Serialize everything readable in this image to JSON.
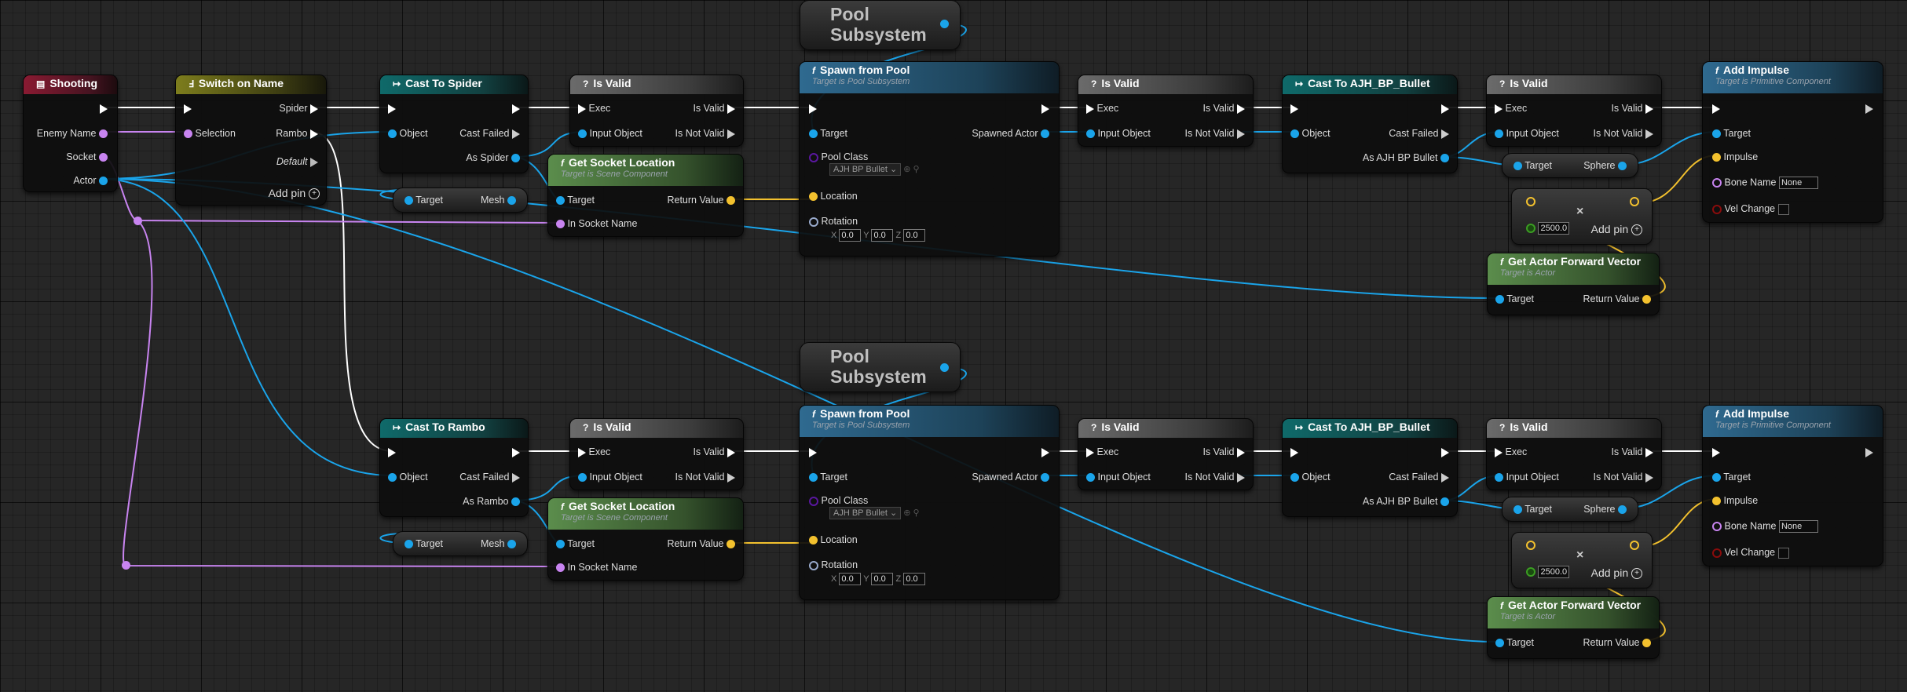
{
  "event_node": {
    "title": "Shooting",
    "pins": {
      "enemy_name": "Enemy Name",
      "socket": "Socket",
      "actor": "Actor"
    }
  },
  "switch_node": {
    "title": "Switch on Name",
    "selection": "Selection",
    "spider": "Spider",
    "rambo": "Rambo",
    "default": "Default",
    "add_pin": "Add pin"
  },
  "pool_subsystem": {
    "label_1": "Pool",
    "label_2": "Subsystem"
  },
  "common": {
    "exec": "Exec",
    "object": "Object",
    "cast_failed": "Cast Failed",
    "is_valid": "Is Valid",
    "is_not_valid": "Is Not Valid",
    "input_object": "Input Object",
    "target": "Target",
    "mesh": "Mesh",
    "sphere": "Sphere",
    "return_value": "Return Value",
    "in_socket_name": "In Socket Name",
    "pool_class": "Pool Class",
    "pool_class_value": "AJH BP Bullet",
    "location": "Location",
    "rotation": "Rotation",
    "spawned_actor": "Spawned Actor",
    "rot_x": "X",
    "rot_y": "Y",
    "rot_z": "Z",
    "rot_value": "0.0",
    "impulse": "Impulse",
    "bone_name": "Bone Name",
    "bone_name_value": "None",
    "vel_change": "Vel Change",
    "mult_value": "2500.0",
    "add_pin": "Add pin",
    "as_bullet": "As AJH BP Bullet"
  },
  "titles": {
    "cast_spider": "Cast To Spider",
    "cast_rambo": "Cast To Rambo",
    "is_valid": "Is Valid",
    "get_socket_location": "Get Socket Location",
    "target_scene_component": "Target is Scene Component",
    "spawn_from_pool": "Spawn from Pool",
    "target_pool_subsystem": "Target is Pool Subsystem",
    "cast_bullet": "Cast To AJH_BP_Bullet",
    "add_impulse": "Add Impulse",
    "target_primitive": "Target is Primitive Component",
    "get_forward": "Get Actor Forward Vector",
    "target_actor": "Target is Actor"
  },
  "as_spider": "As Spider",
  "as_rambo": "As Rambo",
  "colors": {
    "exec": "#ffffff",
    "object": "#1aa4ea",
    "name": "#c884f0",
    "vector": "#f3c12e",
    "float": "#3b9d22"
  }
}
